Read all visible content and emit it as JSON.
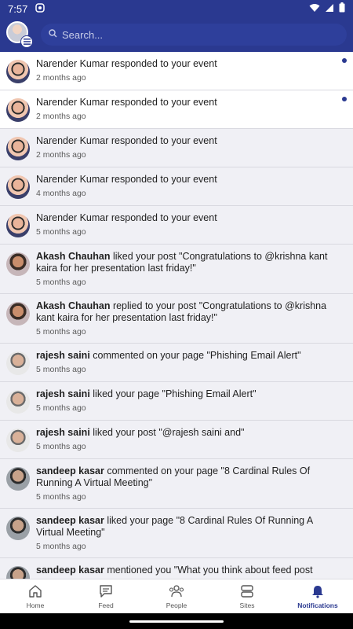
{
  "status_bar": {
    "time": "7:57"
  },
  "search": {
    "placeholder": "Search..."
  },
  "notifications": [
    {
      "avatar": "narender",
      "actor": "",
      "text": "Narender Kumar responded to your event",
      "time": "2 months ago",
      "unread": true
    },
    {
      "avatar": "narender",
      "actor": "",
      "text": "Narender Kumar responded to your event",
      "time": "2 months ago",
      "unread": true
    },
    {
      "avatar": "narender",
      "actor": "",
      "text": "Narender Kumar responded to your event",
      "time": "2 months ago",
      "unread": false
    },
    {
      "avatar": "narender",
      "actor": "",
      "text": "Narender Kumar responded to your event",
      "time": "4 months ago",
      "unread": false
    },
    {
      "avatar": "narender",
      "actor": "",
      "text": "Narender Kumar responded to your event",
      "time": "5 months ago",
      "unread": false
    },
    {
      "avatar": "akash",
      "actor": "Akash Chauhan",
      "text": " liked your post \"Congratulations to @krishna kant kaira for her presentation last friday!\"",
      "time": "5 months ago",
      "unread": false
    },
    {
      "avatar": "akash",
      "actor": "Akash Chauhan",
      "text": " replied to your post \"Congratulations to @krishna kant kaira for her presentation last friday!\"",
      "time": "5 months ago",
      "unread": false
    },
    {
      "avatar": "rajesh",
      "actor": "rajesh saini",
      "text": " commented on your page \"Phishing Email Alert\"",
      "time": "5 months ago",
      "unread": false
    },
    {
      "avatar": "rajesh",
      "actor": "rajesh saini",
      "text": " liked your page \"Phishing Email Alert\"",
      "time": "5 months ago",
      "unread": false
    },
    {
      "avatar": "rajesh",
      "actor": "rajesh saini",
      "text": " liked your post \"@rajesh saini and\"",
      "time": "5 months ago",
      "unread": false
    },
    {
      "avatar": "sandeep",
      "actor": "sandeep kasar",
      "text": " commented on your page \"8 Cardinal Rules Of Running A Virtual Meeting\"",
      "time": "5 months ago",
      "unread": false
    },
    {
      "avatar": "sandeep",
      "actor": "sandeep kasar",
      "text": " liked your page \"8 Cardinal Rules Of Running A Virtual Meeting\"",
      "time": "5 months ago",
      "unread": false
    },
    {
      "avatar": "sandeep",
      "actor": "sandeep kasar",
      "text": " mentioned you \"What you think about feed post",
      "time": "",
      "unread": false
    }
  ],
  "bottom_nav": [
    {
      "key": "home",
      "label": "Home",
      "icon": "home-icon",
      "active": false
    },
    {
      "key": "feed",
      "label": "Feed",
      "icon": "feed-icon",
      "active": false
    },
    {
      "key": "people",
      "label": "People",
      "icon": "people-icon",
      "active": false
    },
    {
      "key": "sites",
      "label": "Sites",
      "icon": "sites-icon",
      "active": false
    },
    {
      "key": "notifications",
      "label": "Notifications",
      "icon": "bell-icon",
      "active": true
    }
  ],
  "colors": {
    "brand": "#2a3990",
    "unread_bg": "#ffffff",
    "read_bg": "#f0f0f5"
  }
}
